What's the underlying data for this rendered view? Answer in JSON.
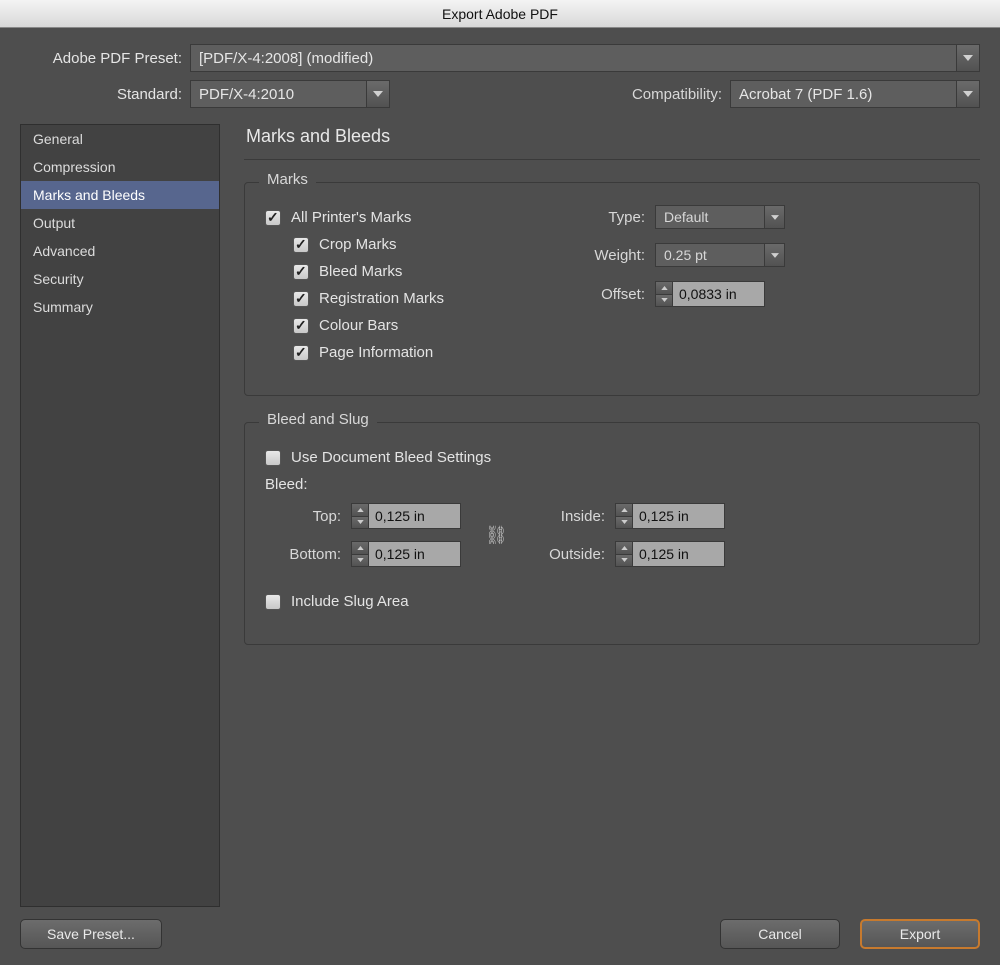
{
  "title": "Export Adobe PDF",
  "preset": {
    "label": "Adobe PDF Preset:",
    "value": "[PDF/X-4:2008] (modified)"
  },
  "standard": {
    "label": "Standard:",
    "value": "PDF/X-4:2010"
  },
  "compatibility": {
    "label": "Compatibility:",
    "value": "Acrobat 7 (PDF 1.6)"
  },
  "sidebar": {
    "items": [
      "General",
      "Compression",
      "Marks and Bleeds",
      "Output",
      "Advanced",
      "Security",
      "Summary"
    ],
    "selected": 2
  },
  "section_title": "Marks and Bleeds",
  "marks_group": {
    "legend": "Marks",
    "all": "All Printer's Marks",
    "crop": "Crop Marks",
    "bleed": "Bleed Marks",
    "registration": "Registration Marks",
    "colour": "Colour Bars",
    "pageinfo": "Page Information",
    "type": {
      "label": "Type:",
      "value": "Default"
    },
    "weight": {
      "label": "Weight:",
      "value": "0.25 pt"
    },
    "offset": {
      "label": "Offset:",
      "value": "0,0833 in"
    }
  },
  "bleed_group": {
    "legend": "Bleed and Slug",
    "use_doc": "Use Document Bleed Settings",
    "bleed_heading": "Bleed:",
    "top": {
      "label": "Top:",
      "value": "0,125 in"
    },
    "bottom": {
      "label": "Bottom:",
      "value": "0,125 in"
    },
    "inside": {
      "label": "Inside:",
      "value": "0,125 in"
    },
    "outside": {
      "label": "Outside:",
      "value": "0,125 in"
    },
    "include_slug": "Include Slug Area"
  },
  "footer": {
    "save_preset": "Save Preset...",
    "cancel": "Cancel",
    "export": "Export"
  }
}
